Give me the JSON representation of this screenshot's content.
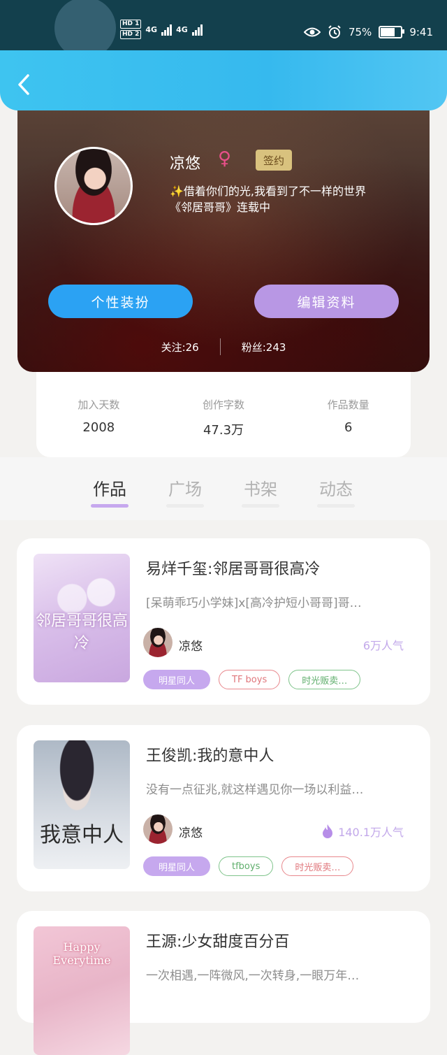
{
  "status_bar": {
    "hd1": "HD 1",
    "hd2": "HD 2",
    "net1": "4G",
    "net2": "4G",
    "battery_percent": "75%",
    "battery_level": 0.75,
    "time": "9:41"
  },
  "profile": {
    "name": "凉悠",
    "gender_symbol": "♀",
    "badge": "签约",
    "bio_line1": "借着你们的光,我看到了不一样的世界",
    "bio_line2": "《邻居哥哥》连载中",
    "dress_button": "个性装扮",
    "edit_button": "编辑资料",
    "following": "关注:26",
    "fans": "粉丝:243"
  },
  "stats": [
    {
      "label": "加入天数",
      "value": "2008"
    },
    {
      "label": "创作字数",
      "value": "47.3万"
    },
    {
      "label": "作品数量",
      "value": "6"
    }
  ],
  "tabs": [
    "作品",
    "广场",
    "书架",
    "动态"
  ],
  "books": [
    {
      "title": "易烊千玺:邻居哥哥很高冷",
      "desc": "[呆萌乖巧小学妹]x[高冷护短小哥哥]哥…",
      "author": "凉悠",
      "popularity": "6万人气",
      "cover_text": "邻居哥哥很高冷",
      "tags": [
        "明星同人",
        "TF boys",
        "时光贩卖…"
      ]
    },
    {
      "title": "王俊凯:我的意中人",
      "desc": "没有一点征兆,就这样遇见你一场以利益…",
      "author": "凉悠",
      "popularity": "140.1万人气",
      "cover_text": "我意中人",
      "tags": [
        "明星同人",
        "tfboys",
        "时光贩卖…"
      ]
    },
    {
      "title": "王源:少女甜度百分百",
      "desc": "一次相遇,一阵微风,一次转身,一眼万年…",
      "author": "",
      "popularity": "",
      "cover_text": "Happy Everytime",
      "tags": []
    }
  ],
  "colors": {
    "header": "#3ec4f0",
    "accent_purple": "#c6a8ee",
    "accent_blue": "#2ba2f3"
  }
}
